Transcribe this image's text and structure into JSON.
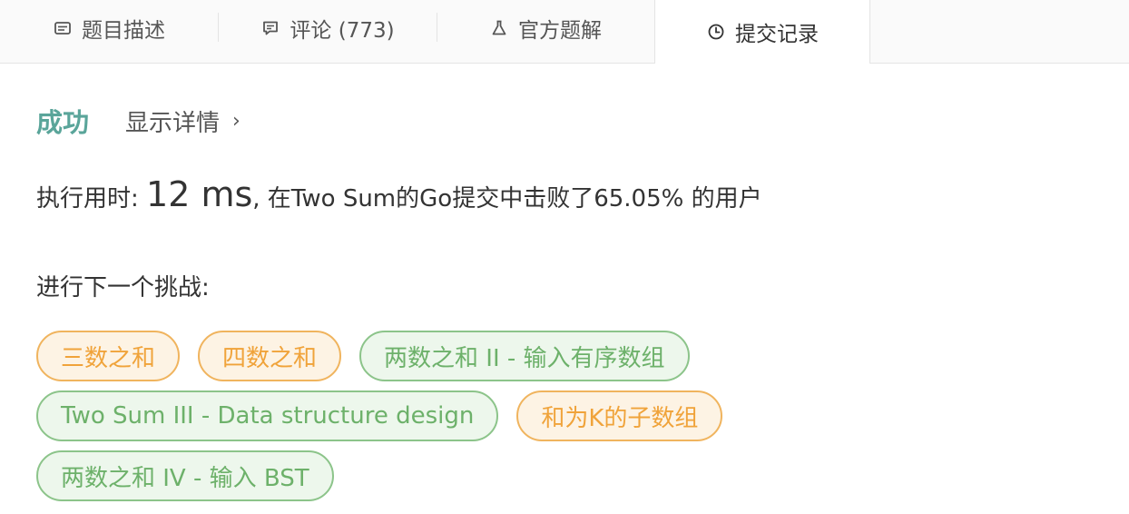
{
  "tabs": [
    {
      "label": "题目描述",
      "icon": "description-icon"
    },
    {
      "label": "评论 (773)",
      "icon": "comment-icon"
    },
    {
      "label": "官方题解",
      "icon": "flask-icon"
    },
    {
      "label": "提交记录",
      "icon": "clock-icon",
      "active": true
    }
  ],
  "result": {
    "status": "成功",
    "details_label": "显示详情",
    "chevron": "›"
  },
  "runtime": {
    "prefix": "执行用时: ",
    "value": "12 ms",
    "suffix": ", 在Two Sum的Go提交中击败了65.05% 的用户"
  },
  "challenge": {
    "label": "进行下一个挑战:",
    "items": [
      {
        "label": "三数之和",
        "difficulty": "medium"
      },
      {
        "label": "四数之和",
        "difficulty": "medium"
      },
      {
        "label": "两数之和 II - 输入有序数组",
        "difficulty": "easy"
      },
      {
        "label": "Two Sum III - Data structure design",
        "difficulty": "easy"
      },
      {
        "label": "和为K的子数组",
        "difficulty": "medium"
      },
      {
        "label": "两数之和 IV - 输入 BST",
        "difficulty": "easy"
      }
    ]
  },
  "colors": {
    "success": "#5aa59a",
    "medium": "#f0a33a",
    "easy": "#6db16a"
  }
}
